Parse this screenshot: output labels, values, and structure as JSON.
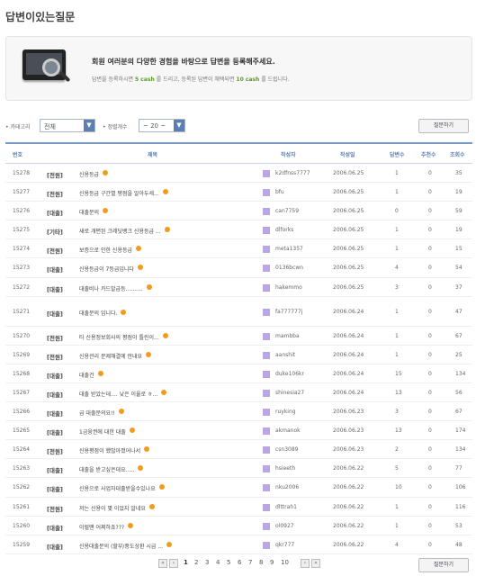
{
  "page": {
    "title": "답변이있는질문"
  },
  "banner": {
    "main": "회원 여러분의 다양한 경험을 바탕으로 답변을 등록해주세요.",
    "sub_prefix": "답변을 등록하시면",
    "sub_cash1": "5 cash",
    "sub_mid": "를 드리고, 등록된 답변이 채택되면",
    "sub_cash2": "10 cash",
    "sub_suffix": "를 드립니다."
  },
  "filters": {
    "category_label": "• 카테고리",
    "category_value": "전체",
    "per_page_label": "• 정렬개수",
    "per_page_value": "~ 20 ~",
    "write_label": "질문하기"
  },
  "table": {
    "headers": {
      "no": "번호",
      "title": "제목",
      "author": "작성자",
      "date": "작성일",
      "answers": "답변수",
      "recommend": "추천수",
      "views": "조회수"
    },
    "rows": [
      {
        "no": "15278",
        "cat": "[전원]",
        "title": "신용등급",
        "author": "k2dfnss7777",
        "date": "2006.06.25",
        "ans": "1",
        "rec": "0",
        "views": "35"
      },
      {
        "no": "15277",
        "cat": "[전원]",
        "title": "신용등급 구간별 평점을 알아두세...",
        "author": "bfu",
        "date": "2006.06.25",
        "ans": "1",
        "rec": "0",
        "views": "19"
      },
      {
        "no": "15276",
        "cat": "[대출]",
        "title": "대출문의",
        "author": "can7759",
        "date": "2006.06.25",
        "ans": "0",
        "rec": "0",
        "views": "59"
      },
      {
        "no": "15275",
        "cat": "[기타]",
        "title": "새로 개편된 크레딧뱅크 신용등급 ...",
        "author": "dlforks",
        "date": "2006.06.25",
        "ans": "1",
        "rec": "0",
        "views": "19"
      },
      {
        "no": "15274",
        "cat": "[전원]",
        "title": "보증으로 인한 신용등급",
        "author": "meta1357",
        "date": "2006.06.25",
        "ans": "1",
        "rec": "0",
        "views": "15"
      },
      {
        "no": "15273",
        "cat": "[대출]",
        "title": "신용등급이 7등급입니다",
        "author": "0136bcwn",
        "date": "2006.06.25",
        "ans": "4",
        "rec": "0",
        "views": "54"
      },
      {
        "no": "15272",
        "cat": "[대출]",
        "title": "대출비나 카드발급등..........",
        "author": "hakemmo",
        "date": "2006.06.25",
        "ans": "3",
        "rec": "0",
        "views": "37"
      },
      {
        "no": "15271",
        "cat": "[대출]",
        "title": "대출문의 입니다.",
        "author": "fa777777j",
        "date": "2006.06.24",
        "ans": "1",
        "rec": "0",
        "views": "47",
        "tall": true
      },
      {
        "no": "15270",
        "cat": "[전원]",
        "title": "타 신용정보회사의 평점이 틀린이...",
        "author": "mambba",
        "date": "2006.06.24",
        "ans": "1",
        "rec": "0",
        "views": "67"
      },
      {
        "no": "15269",
        "cat": "[전원]",
        "title": "신용관리 문제해결에 안내요",
        "author": "aanshit",
        "date": "2006.06.24",
        "ans": "1",
        "rec": "0",
        "views": "25"
      },
      {
        "no": "15268",
        "cat": "[대출]",
        "title": "대출건",
        "author": "duke106kr",
        "date": "2006.06.24",
        "ans": "15",
        "rec": "0",
        "views": "134"
      },
      {
        "no": "15267",
        "cat": "[대출]",
        "title": "대출 받았는데.... 낮은 이율로 ㅎ...",
        "author": "shinesia27",
        "date": "2006.06.24",
        "ans": "13",
        "rec": "0",
        "views": "56"
      },
      {
        "no": "15266",
        "cat": "[대출]",
        "title": "급 대출문의요!!",
        "author": "ruyking",
        "date": "2006.06.23",
        "ans": "3",
        "rec": "0",
        "views": "67"
      },
      {
        "no": "15265",
        "cat": "[대출]",
        "title": "1금융권에 대한 대출",
        "author": "akmanok",
        "date": "2006.06.23",
        "ans": "13",
        "rec": "0",
        "views": "174"
      },
      {
        "no": "15264",
        "cat": "[전원]",
        "title": "신용평점이 했많아졌어나서",
        "author": "csn3089",
        "date": "2006.06.23",
        "ans": "2",
        "rec": "0",
        "views": "134"
      },
      {
        "no": "15263",
        "cat": "[대출]",
        "title": "대출을 받고싶은데요.....",
        "author": "hsieeth",
        "date": "2006.06.22",
        "ans": "5",
        "rec": "0",
        "views": "77"
      },
      {
        "no": "15262",
        "cat": "[대출]",
        "title": "신용으로 사업자대출받을수있나요",
        "author": "nku2006",
        "date": "2006.06.22",
        "ans": "10",
        "rec": "0",
        "views": "106"
      },
      {
        "no": "15261",
        "cat": "[전원]",
        "title": "저는 신용이 몇 이었지 알네요",
        "author": "dlttrah1",
        "date": "2006.06.22",
        "ans": "1",
        "rec": "0",
        "views": "116"
      },
      {
        "no": "15260",
        "cat": "[대출]",
        "title": "이럴땐 어쩌하죠???",
        "author": "ol0927",
        "date": "2006.06.22",
        "ans": "1",
        "rec": "0",
        "views": "53"
      },
      {
        "no": "15259",
        "cat": "[대출]",
        "title": "신용대출문의 (할부/중도상환 시급 ...",
        "author": "qkr777",
        "date": "2006.06.22",
        "ans": "4",
        "rec": "0",
        "views": "48"
      }
    ]
  },
  "pager": {
    "first": "«",
    "prev": "‹",
    "pages": [
      "1",
      "2",
      "3",
      "4",
      "5",
      "6",
      "7",
      "8",
      "9",
      "10"
    ],
    "current": "1",
    "next": "›",
    "last": "»"
  },
  "bottom": {
    "write_label": "질문하기"
  },
  "colors": {
    "accent": "#5c7fb3",
    "dot": "#f29b1d",
    "avatar": "#b9a6e2"
  }
}
